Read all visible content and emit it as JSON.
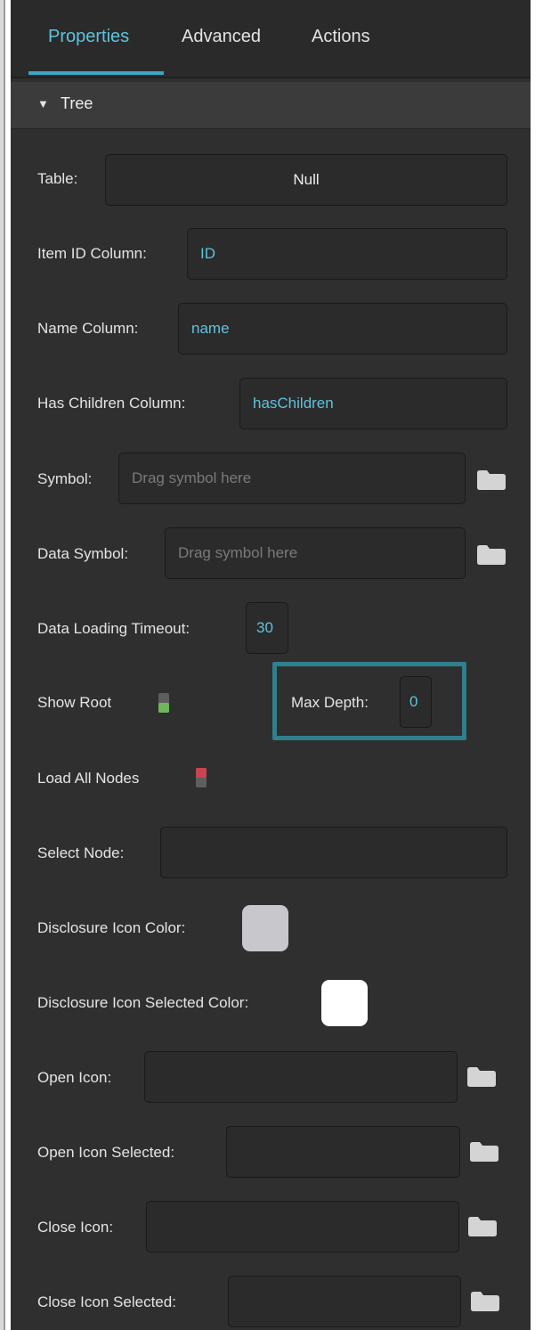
{
  "tabs": [
    {
      "label": "Properties",
      "active": true
    },
    {
      "label": "Advanced",
      "active": false
    },
    {
      "label": "Actions",
      "active": false
    }
  ],
  "section": {
    "title": "Tree",
    "expanded": true
  },
  "fields": {
    "table": {
      "label": "Table:",
      "value": "Null"
    },
    "item_id_column": {
      "label": "Item ID Column:",
      "value": "ID"
    },
    "name_column": {
      "label": "Name Column:",
      "value": "name"
    },
    "has_children_column": {
      "label": "Has Children Column:",
      "value": "hasChildren"
    },
    "symbol": {
      "label": "Symbol:",
      "placeholder": "Drag symbol here"
    },
    "data_symbol": {
      "label": "Data Symbol:",
      "placeholder": "Drag symbol here"
    },
    "data_loading_timeout": {
      "label": "Data Loading Timeout:",
      "value": "30"
    },
    "show_root": {
      "label": "Show Root",
      "on": true
    },
    "max_depth": {
      "label": "Max Depth:",
      "value": "0"
    },
    "load_all_nodes": {
      "label": "Load All Nodes",
      "on": false
    },
    "select_node": {
      "label": "Select Node:",
      "value": ""
    },
    "disclosure_icon_color": {
      "label": "Disclosure Icon Color:",
      "color": "#c8c8cc"
    },
    "disclosure_icon_selected_color": {
      "label": "Disclosure Icon Selected Color:",
      "color": "#ffffff"
    },
    "open_icon": {
      "label": "Open Icon:",
      "value": ""
    },
    "open_icon_selected": {
      "label": "Open Icon Selected:",
      "value": ""
    },
    "close_icon": {
      "label": "Close Icon:",
      "value": ""
    },
    "close_icon_selected": {
      "label": "Close Icon Selected:",
      "value": ""
    }
  },
  "colors": {
    "accent": "#5ec3df",
    "toggle_on": "#6fb75c",
    "toggle_off": "#c9444f",
    "highlight": "#2f7f8c"
  },
  "icons": [
    "folder-icon",
    "disclosure-triangle-icon"
  ]
}
